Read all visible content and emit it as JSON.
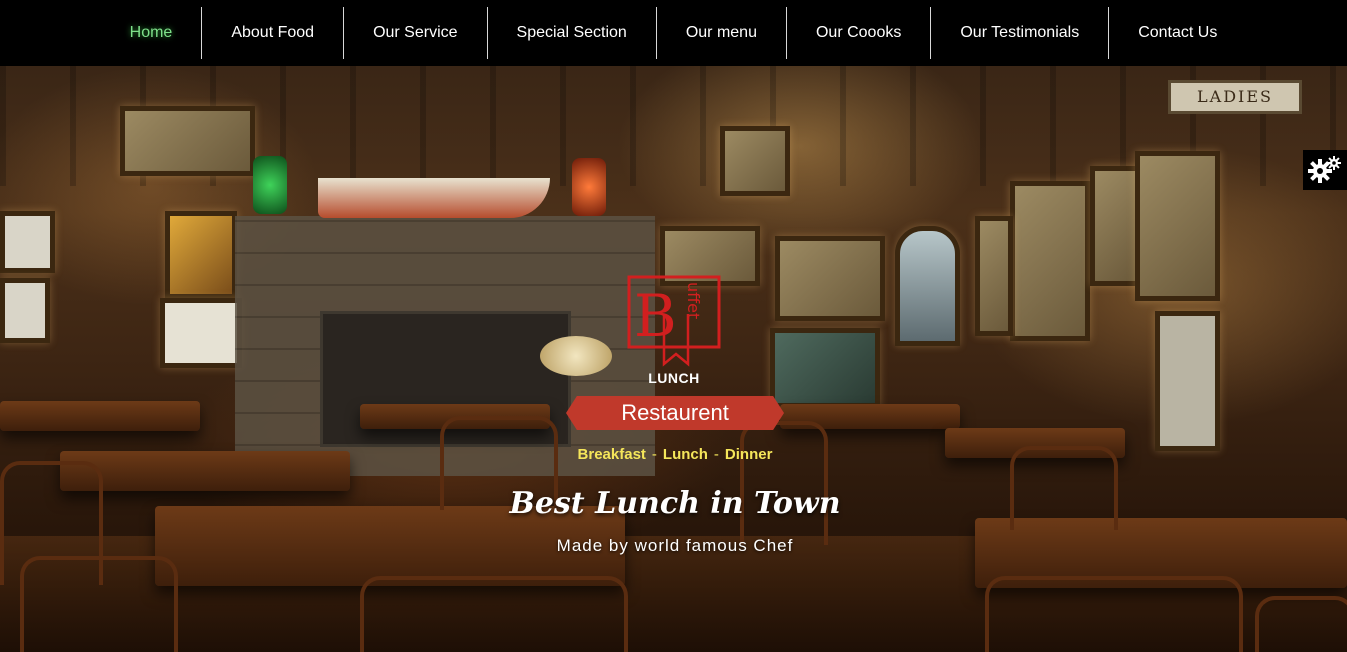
{
  "nav": {
    "items": [
      {
        "label": "Home",
        "active": true
      },
      {
        "label": "About Food"
      },
      {
        "label": "Our Service"
      },
      {
        "label": "Special Section"
      },
      {
        "label": "Our menu"
      },
      {
        "label": "Our Coooks"
      },
      {
        "label": "Our Testimonials"
      },
      {
        "label": "Contact Us"
      }
    ]
  },
  "hero": {
    "logo_letter": "B",
    "logo_word": "uffet",
    "badge": "LUNCH",
    "ribbon": "Restaurent",
    "meals": [
      "Breakfast",
      "Lunch",
      "Dinner"
    ],
    "meal_separator": "-",
    "title": "Best Lunch in Town",
    "subtitle": "Made by world famous Chef",
    "sign": "LADIES"
  },
  "settings": {
    "icon": "gear-icon"
  },
  "colors": {
    "accent": "#c0392b",
    "nav_active": "#7ee08a",
    "meals": "#f5e65a",
    "nav_bg": "#000000"
  }
}
